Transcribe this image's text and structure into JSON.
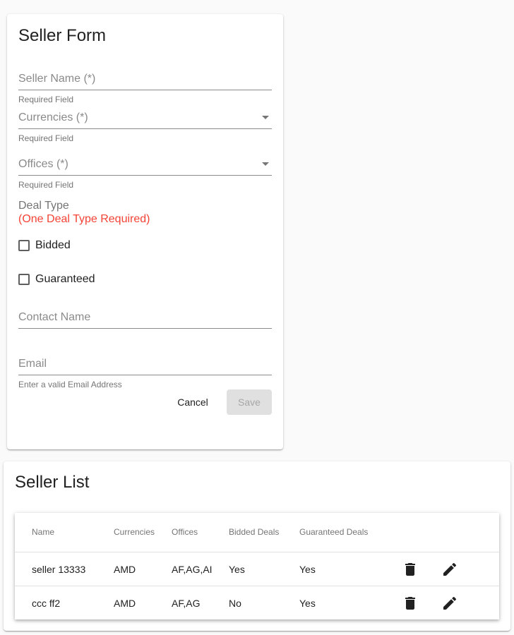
{
  "form": {
    "title": "Seller Form",
    "seller_name": {
      "label": "Seller Name (*)",
      "helper": "Required Field",
      "value": ""
    },
    "currencies": {
      "label": "Currencies (*)",
      "helper": "Required Field",
      "value": ""
    },
    "offices": {
      "label": "Offices (*)",
      "helper": "Required Field",
      "value": ""
    },
    "deal_type": {
      "title": "Deal Type",
      "error": "(One Deal Type Required)",
      "options": [
        {
          "label": "Bidded",
          "checked": false
        },
        {
          "label": "Guaranteed",
          "checked": false
        }
      ]
    },
    "contact_name": {
      "label": "Contact Name",
      "value": ""
    },
    "email": {
      "label": "Email",
      "helper": "Enter a valid Email Address",
      "value": ""
    },
    "cancel_label": "Cancel",
    "save_label": "Save"
  },
  "list": {
    "title": "Seller List",
    "columns": [
      "Name",
      "Currencies",
      "Offices",
      "Bidded Deals",
      "Guaranteed Deals"
    ],
    "rows": [
      {
        "name": "seller 13333",
        "currencies": "AMD",
        "offices": "AF,AG,AI",
        "bidded": "Yes",
        "guaranteed": "Yes"
      },
      {
        "name": "ccc ff2",
        "currencies": "AMD",
        "offices": "AF,AG",
        "bidded": "No",
        "guaranteed": "Yes"
      }
    ],
    "row_icons": [
      "delete-icon",
      "edit-icon"
    ]
  },
  "colors": {
    "error": "#f44336",
    "disabled_button_bg": "#e0e0e0",
    "background": "#fafafa"
  }
}
